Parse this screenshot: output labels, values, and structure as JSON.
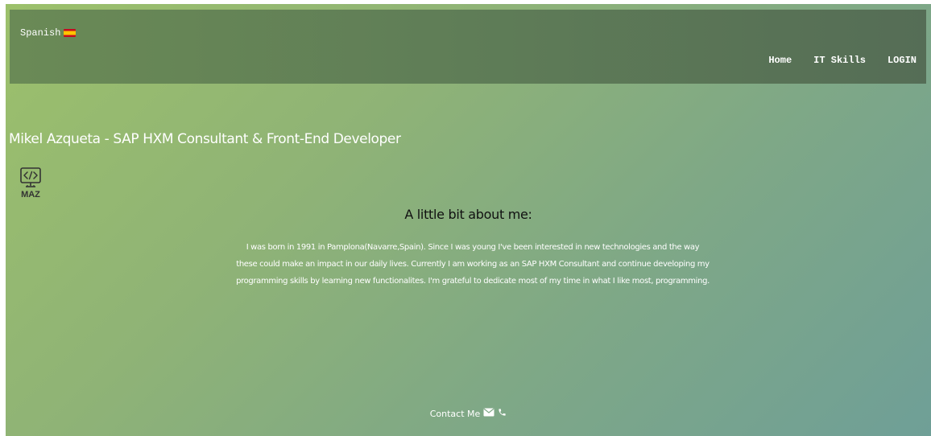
{
  "header": {
    "language_label": "Spanish",
    "nav": {
      "home": "Home",
      "it_skills": "IT Skills",
      "login": "LOGIN"
    }
  },
  "main": {
    "title": "Mikel Azqueta - SAP HXM Consultant & Front-End Developer",
    "logo_text": "MAZ",
    "about_heading": "A little bit about me:",
    "about_text": "I was born in 1991 in Pamplona(Navarre,Spain). Since I was young I've been interested in new technologies and the way these could make an impact in our daily lives. Currently I am working as an SAP HXM Consultant and continue developing my programming skills by learning new functionalites. I'm grateful to dedicate most of my time in what I like most, programming."
  },
  "footer": {
    "contact_label": "Contact Me"
  },
  "icons": {
    "language": "spain-flag-icon",
    "logo": "code-monitor-icon",
    "email": "envelope-icon",
    "phone": "phone-icon"
  },
  "colors": {
    "nav_bg": "#5f7d57",
    "gradient_start": "#9cc06b",
    "gradient_end": "#6f9f97",
    "heading_text": "#111111",
    "light_text": "#ffffff"
  }
}
